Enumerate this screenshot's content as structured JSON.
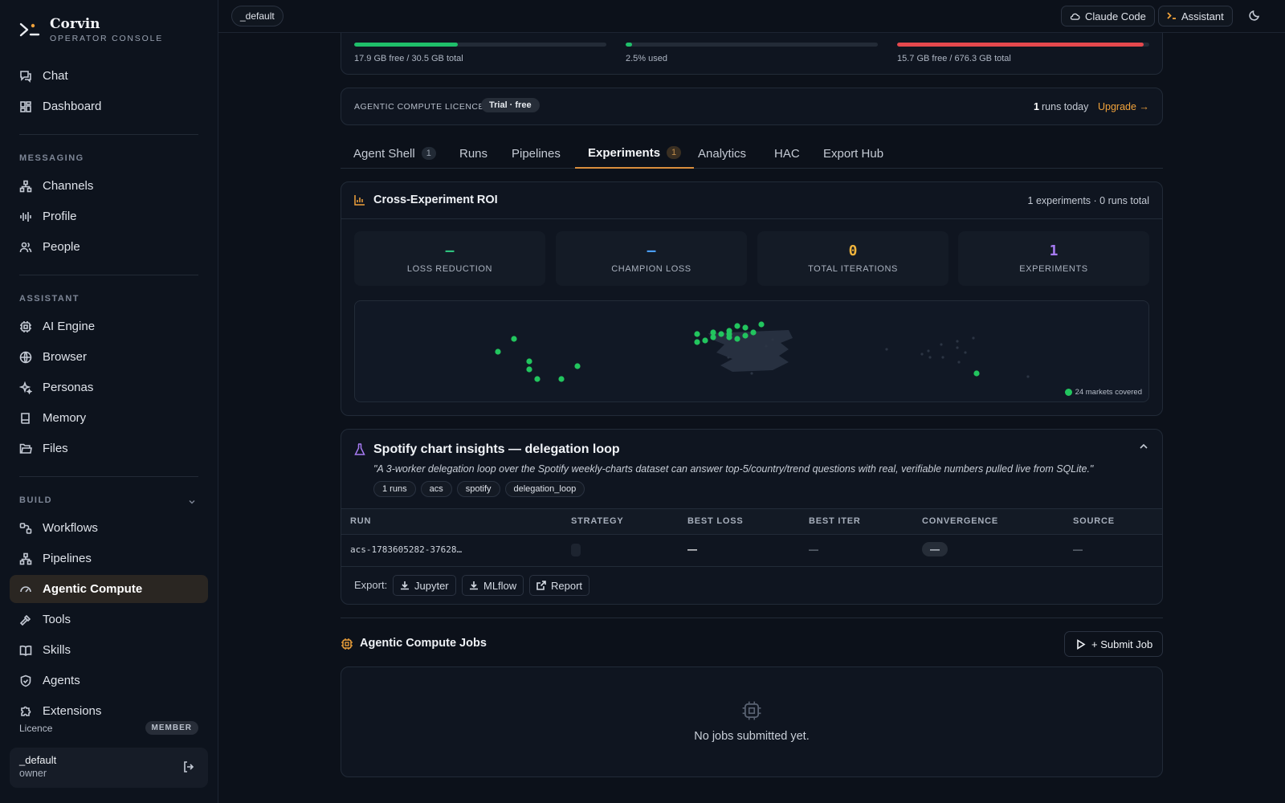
{
  "brand": {
    "name": "Corvin",
    "subtitle": "OPERATOR CONSOLE"
  },
  "sidebar": {
    "top_items": [
      {
        "label": "Chat",
        "icon": "chat-icon"
      },
      {
        "label": "Dashboard",
        "icon": "dashboard-icon"
      }
    ],
    "sections": [
      {
        "title": "MESSAGING",
        "items": [
          {
            "label": "Channels",
            "icon": "channels-icon"
          },
          {
            "label": "Profile",
            "icon": "waveform-icon"
          },
          {
            "label": "People",
            "icon": "people-icon"
          }
        ]
      },
      {
        "title": "ASSISTANT",
        "items": [
          {
            "label": "AI Engine",
            "icon": "chip-icon"
          },
          {
            "label": "Browser",
            "icon": "globe-icon"
          },
          {
            "label": "Personas",
            "icon": "sparkles-icon"
          },
          {
            "label": "Memory",
            "icon": "book-icon"
          },
          {
            "label": "Files",
            "icon": "folder-icon"
          }
        ]
      },
      {
        "title": "BUILD",
        "items": [
          {
            "label": "Workflows",
            "icon": "workflow-icon"
          },
          {
            "label": "Pipelines",
            "icon": "pipeline-icon"
          },
          {
            "label": "Agentic Compute",
            "icon": "gauge-icon",
            "active": true
          },
          {
            "label": "Tools",
            "icon": "hammer-icon"
          },
          {
            "label": "Skills",
            "icon": "book-open-icon"
          },
          {
            "label": "Agents",
            "icon": "shield-icon"
          },
          {
            "label": "Extensions",
            "icon": "puzzle-icon"
          }
        ]
      }
    ],
    "licence": {
      "label": "Licence",
      "badge": "MEMBER"
    },
    "user": {
      "name": "_default",
      "role": "owner"
    }
  },
  "topbar": {
    "workspace": "_default",
    "claude_code": "Claude Code",
    "assistant": "Assistant"
  },
  "resources": [
    {
      "detail": "17.9 GB free / 30.5 GB total",
      "fill": 0.41,
      "color": "#1fbf6a"
    },
    {
      "detail": "2.5% used",
      "fill": 0.025,
      "color": "#1fbf6a"
    },
    {
      "detail": "15.7 GB free / 676.3 GB total",
      "fill": 0.977,
      "color": "#e5484d"
    }
  ],
  "licence_bar": {
    "label": "AGENTIC COMPUTE LICENCE",
    "plan": "Trial · free",
    "runs_count": "1",
    "runs_text": "runs today",
    "upgrade": "Upgrade →"
  },
  "tabs": [
    {
      "label": "Agent Shell",
      "count": "1"
    },
    {
      "label": "Runs"
    },
    {
      "label": "Pipelines"
    },
    {
      "label": "Experiments",
      "count": "1",
      "active": true
    },
    {
      "label": "Analytics"
    },
    {
      "label": "HAC"
    },
    {
      "label": "Export Hub"
    }
  ],
  "roi": {
    "title": "Cross-Experiment ROI",
    "summary": "1 experiments · 0 runs total",
    "stats": [
      {
        "value": "–",
        "label": "LOSS REDUCTION",
        "color": "#2ec27e"
      },
      {
        "value": "–",
        "label": "CHAMPION LOSS",
        "color": "#4a9eff"
      },
      {
        "value": "0",
        "label": "TOTAL ITERATIONS",
        "color": "#f0b43c"
      },
      {
        "value": "1",
        "label": "EXPERIMENTS",
        "color": "#a77bf3"
      }
    ],
    "map_legend": "24 markets covered"
  },
  "experiment": {
    "title": "Spotify chart insights — delegation loop",
    "hypothesis": "\"A 3-worker delegation loop over the Spotify weekly-charts dataset can answer top-5/country/trend questions with real, verifiable numbers pulled live from SQLite.\"",
    "tags": [
      "1 runs",
      "acs",
      "spotify",
      "delegation_loop"
    ],
    "columns": [
      "RUN",
      "STRATEGY",
      "BEST LOSS",
      "BEST ITER",
      "CONVERGENCE",
      "SOURCE"
    ],
    "row": {
      "run": "acs-1783605282-37628…",
      "best_loss": "—",
      "best_iter": "—",
      "convergence": "—",
      "source": "—"
    },
    "export_label": "Export:",
    "exports": [
      "Jupyter",
      "MLflow",
      "Report"
    ]
  },
  "jobs": {
    "title": "Agentic Compute Jobs",
    "submit": "+ Submit Job",
    "empty": "No jobs submitted yet."
  }
}
